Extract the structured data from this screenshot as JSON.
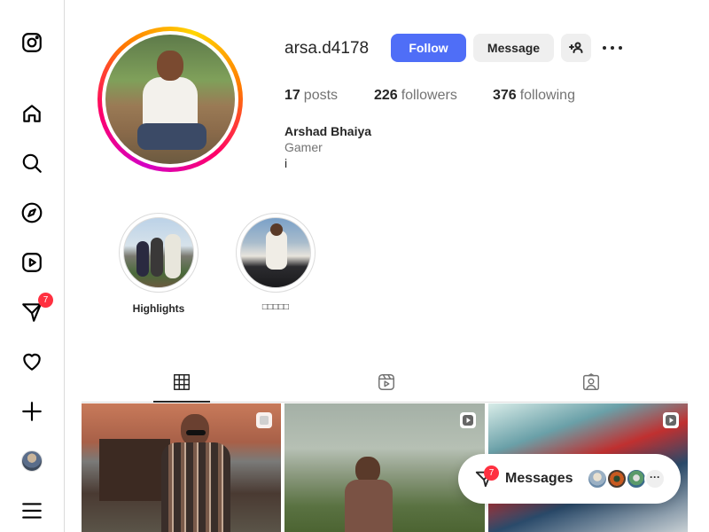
{
  "sidebar": {
    "items": [
      {
        "name": "instagram-logo-icon"
      },
      {
        "name": "home-icon"
      },
      {
        "name": "search-icon"
      },
      {
        "name": "explore-icon"
      },
      {
        "name": "reels-icon"
      },
      {
        "name": "messenger-icon",
        "badge": "7"
      },
      {
        "name": "heart-icon"
      },
      {
        "name": "create-icon"
      },
      {
        "name": "profile-avatar"
      },
      {
        "name": "menu-icon"
      }
    ]
  },
  "profile": {
    "username": "arsa.d4178",
    "follow_label": "Follow",
    "message_label": "Message",
    "stats": {
      "posts_count": "17",
      "posts_label": "posts",
      "followers_count": "226",
      "followers_label": "followers",
      "following_count": "376",
      "following_label": "following"
    },
    "full_name": "Arshad Bhaiya",
    "category": "Gamer",
    "bio": "i"
  },
  "highlights": [
    {
      "label": "Highlights"
    },
    {
      "label": "□□□□□"
    }
  ],
  "tabs": [
    {
      "name": "posts-grid-icon",
      "active": true
    },
    {
      "name": "reels-tab-icon",
      "active": false
    },
    {
      "name": "tagged-icon",
      "active": false
    }
  ],
  "posts": [
    {
      "type": "clip"
    },
    {
      "type": "reel"
    },
    {
      "type": "reel"
    }
  ],
  "messages": {
    "label": "Messages",
    "badge": "7",
    "more": "···"
  },
  "colors": {
    "accent": "#4f6ef7",
    "badge": "#ff3040",
    "border": "#dbdbdb"
  }
}
